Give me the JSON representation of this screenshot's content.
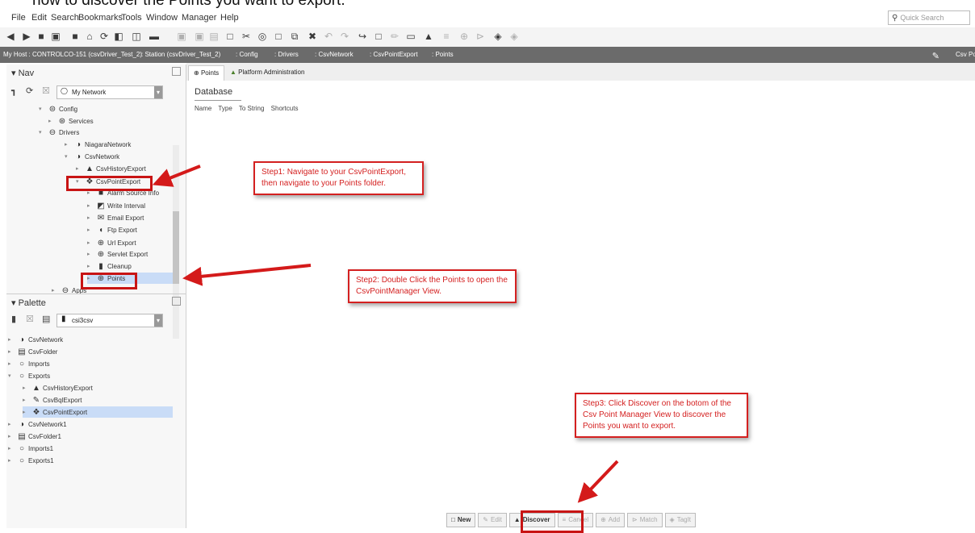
{
  "caption": "now to discover the Points you want to export.",
  "menu": [
    "File",
    "Edit",
    "Search",
    "Bookmarks",
    "Tools",
    "Window",
    "Manager",
    "Help"
  ],
  "quick_search_placeholder": "Quick Search",
  "path": [
    "My Host : CONTROLCO-151 (csvDriver_Test_2)",
    ": Station (csvDriver_Test_2)",
    ": Config",
    ": Drivers",
    ": CsvNetwork",
    ": CsvPointExport",
    ": Points"
  ],
  "path_right": "Csv Po",
  "nav": {
    "title": "Nav",
    "network_combo": "My Network",
    "tree": [
      {
        "label": "Config",
        "icon": "config-icon",
        "state": "open"
      },
      {
        "label": "Services",
        "icon": "services-icon",
        "state": "closed"
      },
      {
        "label": "Drivers",
        "icon": "drivers-icon",
        "state": "open"
      },
      {
        "label": "NiagaraNetwork",
        "icon": "network-icon",
        "state": "closed"
      },
      {
        "label": "CsvNetwork",
        "icon": "network-icon",
        "state": "open"
      },
      {
        "label": "CsvHistoryExport",
        "icon": "history-icon",
        "state": "closed"
      },
      {
        "label": "CsvPointExport",
        "icon": "point-export-icon",
        "state": "open"
      },
      {
        "label": "Alarm Source Info",
        "icon": "alarm-icon",
        "state": "closed"
      },
      {
        "label": "Write Interval",
        "icon": "interval-icon",
        "state": "closed"
      },
      {
        "label": "Email Export",
        "icon": "email-icon",
        "state": "closed"
      },
      {
        "label": "Ftp Export",
        "icon": "ftp-icon",
        "state": "closed"
      },
      {
        "label": "Url Export",
        "icon": "url-icon",
        "state": "closed"
      },
      {
        "label": "Servlet Export",
        "icon": "servlet-icon",
        "state": "closed"
      },
      {
        "label": "Cleanup",
        "icon": "cleanup-icon",
        "state": "closed"
      },
      {
        "label": "Points",
        "icon": "points-icon",
        "state": "closed"
      },
      {
        "label": "Apps",
        "icon": "apps-icon",
        "state": "closed"
      }
    ]
  },
  "palette": {
    "title": "Palette",
    "module_combo": "csi3csv",
    "tree": [
      {
        "label": "CsvNetwork",
        "icon": "network-icon",
        "state": "closed"
      },
      {
        "label": "CsvFolder",
        "icon": "folder-icon",
        "state": "closed"
      },
      {
        "label": "Imports",
        "icon": "imports-icon",
        "state": "closed"
      },
      {
        "label": "Exports",
        "icon": "exports-icon",
        "state": "open"
      },
      {
        "label": "CsvHistoryExport",
        "icon": "history-icon",
        "state": "closed"
      },
      {
        "label": "CsvBqlExport",
        "icon": "bql-icon",
        "state": "closed"
      },
      {
        "label": "CsvPointExport",
        "icon": "point-export-icon",
        "state": "closed"
      },
      {
        "label": "CsvNetwork1",
        "icon": "network-icon",
        "state": "closed"
      },
      {
        "label": "CsvFolder1",
        "icon": "folder-icon",
        "state": "closed"
      },
      {
        "label": "Imports1",
        "icon": "imports-icon",
        "state": "closed"
      },
      {
        "label": "Exports1",
        "icon": "exports-icon",
        "state": "closed"
      }
    ]
  },
  "tabs": [
    "Points",
    "Platform Administration"
  ],
  "database_title": "Database",
  "columns": [
    "Name",
    "Type",
    "To String",
    "Shortcuts"
  ],
  "buttons": [
    {
      "label": "New",
      "icon": "new-icon",
      "enabled": true
    },
    {
      "label": "Edit",
      "icon": "edit-icon",
      "enabled": false
    },
    {
      "label": "Discover",
      "icon": "discover-icon",
      "enabled": true
    },
    {
      "label": "Cancel",
      "icon": "cancel-icon",
      "enabled": false
    },
    {
      "label": "Add",
      "icon": "add-icon",
      "enabled": false
    },
    {
      "label": "Match",
      "icon": "match-icon",
      "enabled": false
    },
    {
      "label": "TagIt",
      "icon": "tagit-icon",
      "enabled": false
    }
  ],
  "callouts": {
    "step1": "Step1: Navigate to your CsvPointExport, then navigate to your Points folder.",
    "step2": "Step2: Double Click the Points to open the CsvPointManager View.",
    "step3": "Step3: Click Discover on the botom of the Csv Point Manager View to discover the Points you want to export."
  },
  "colors": {
    "callout_red": "#d42020",
    "selection": "#c9dcf7",
    "pathbar": "#6b6b6b"
  }
}
